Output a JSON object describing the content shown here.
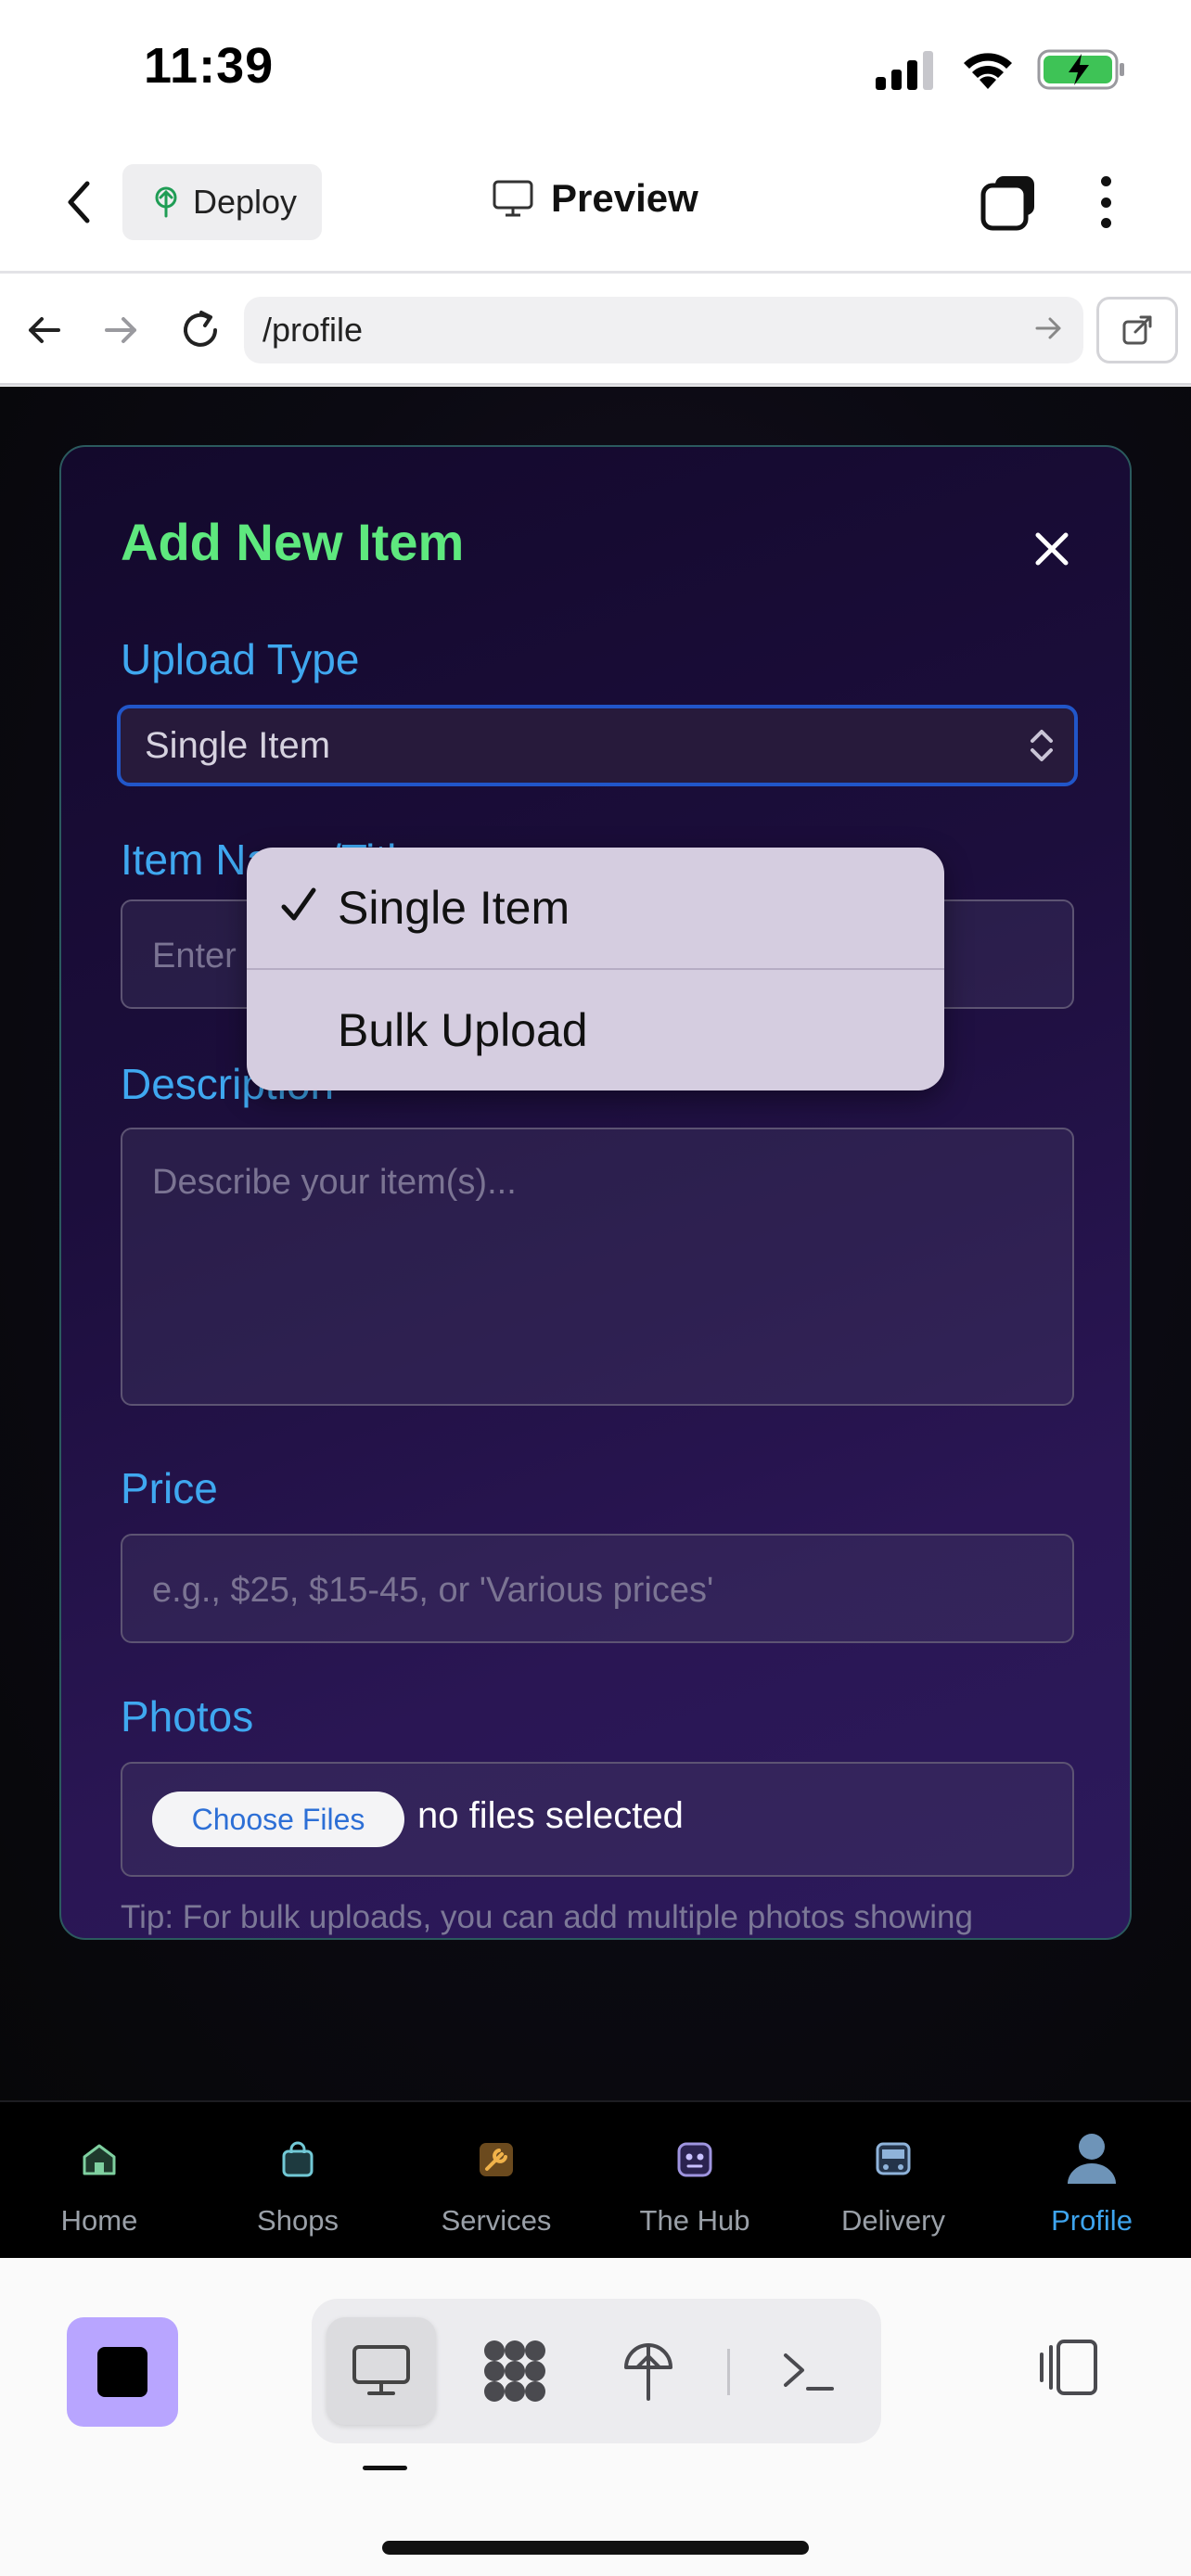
{
  "status": {
    "time": "11:39"
  },
  "app_bar": {
    "deploy_label": "Deploy",
    "title": "Preview"
  },
  "browser": {
    "url": "/profile"
  },
  "modal": {
    "title": "Add New Item",
    "upload_type": {
      "label": "Upload Type",
      "value": "Single Item"
    },
    "item_name": {
      "label": "Item Name/Title",
      "placeholder": "Enter item name"
    },
    "description": {
      "label": "Description",
      "placeholder": "Describe your item(s)..."
    },
    "price": {
      "label": "Price",
      "placeholder": "e.g., $25, $15-45, or 'Various prices'"
    },
    "photos": {
      "label": "Photos",
      "button": "Choose Files",
      "status": "no files selected"
    },
    "tip": "Tip: For bulk uploads, you can add multiple photos showing"
  },
  "dropdown": {
    "options": [
      {
        "label": "Single Item",
        "selected": true
      },
      {
        "label": "Bulk Upload",
        "selected": false
      }
    ]
  },
  "bottom_nav": {
    "items": [
      {
        "label": "Home",
        "icon": "home-icon"
      },
      {
        "label": "Shops",
        "icon": "shopping-bag-icon"
      },
      {
        "label": "Services",
        "icon": "tools-icon"
      },
      {
        "label": "The Hub",
        "icon": "robot-face-icon"
      },
      {
        "label": "Delivery",
        "icon": "bus-icon"
      },
      {
        "label": "Profile",
        "icon": "profile-icon",
        "active": true
      }
    ],
    "active_color": "#3ea4ee"
  },
  "colors": {
    "title_green": "#5ee87e",
    "label_blue": "#3fa8f0",
    "focus_border": "#2156c9",
    "stop_button": "#b8a5ff"
  }
}
